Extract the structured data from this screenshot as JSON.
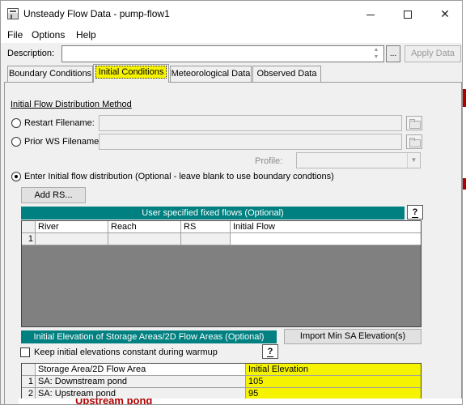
{
  "window": {
    "title": "Unsteady Flow Data - pump-flow1",
    "min_glyph": "–",
    "max_glyph": "□",
    "close_glyph": "✕"
  },
  "menu": [
    "File",
    "Options",
    "Help"
  ],
  "description": {
    "label": "Description:",
    "value": "",
    "browse_label": "...",
    "apply_label": "Apply Data"
  },
  "tabs": [
    "Boundary Conditions",
    "Initial Conditions",
    "Meteorological Data",
    "Observed Data"
  ],
  "active_tab": "Initial Conditions",
  "initial": {
    "section_title": "Initial Flow Distribution Method",
    "restart_label": "Restart Filename:",
    "prior_ws_label": "Prior WS Filename:",
    "profile_label": "Profile:",
    "enter_label": "Enter Initial flow distribution (Optional - leave blank to use boundary condtions)",
    "selected_method": "enter",
    "add_rs_label": "Add RS...",
    "flows_header": "User specified fixed flows (Optional)",
    "help_label": "?",
    "flow_columns": [
      "River",
      "Reach",
      "RS",
      "Initial Flow"
    ],
    "flow_rows": [
      {
        "num": "1",
        "river": "",
        "reach": "",
        "rs": "",
        "flow": ""
      }
    ]
  },
  "storage": {
    "header": "Initial Elevation of Storage Areas/2D Flow Areas (Optional)",
    "import_label": "Import Min SA Elevation(s)",
    "keep_label": "Keep initial elevations constant during warmup",
    "keep_checked": false,
    "help_label": "?",
    "columns": [
      "Storage Area/2D Flow Area",
      "Initial Elevation"
    ],
    "rows": [
      {
        "num": "1",
        "area": "SA: Downstream pond",
        "elev": "105"
      },
      {
        "num": "2",
        "area": "SA: Upstream pond",
        "elev": "95"
      }
    ]
  },
  "background_text": "Upstream pond",
  "colors": {
    "teal": "#008080",
    "highlight": "#f5f300"
  }
}
